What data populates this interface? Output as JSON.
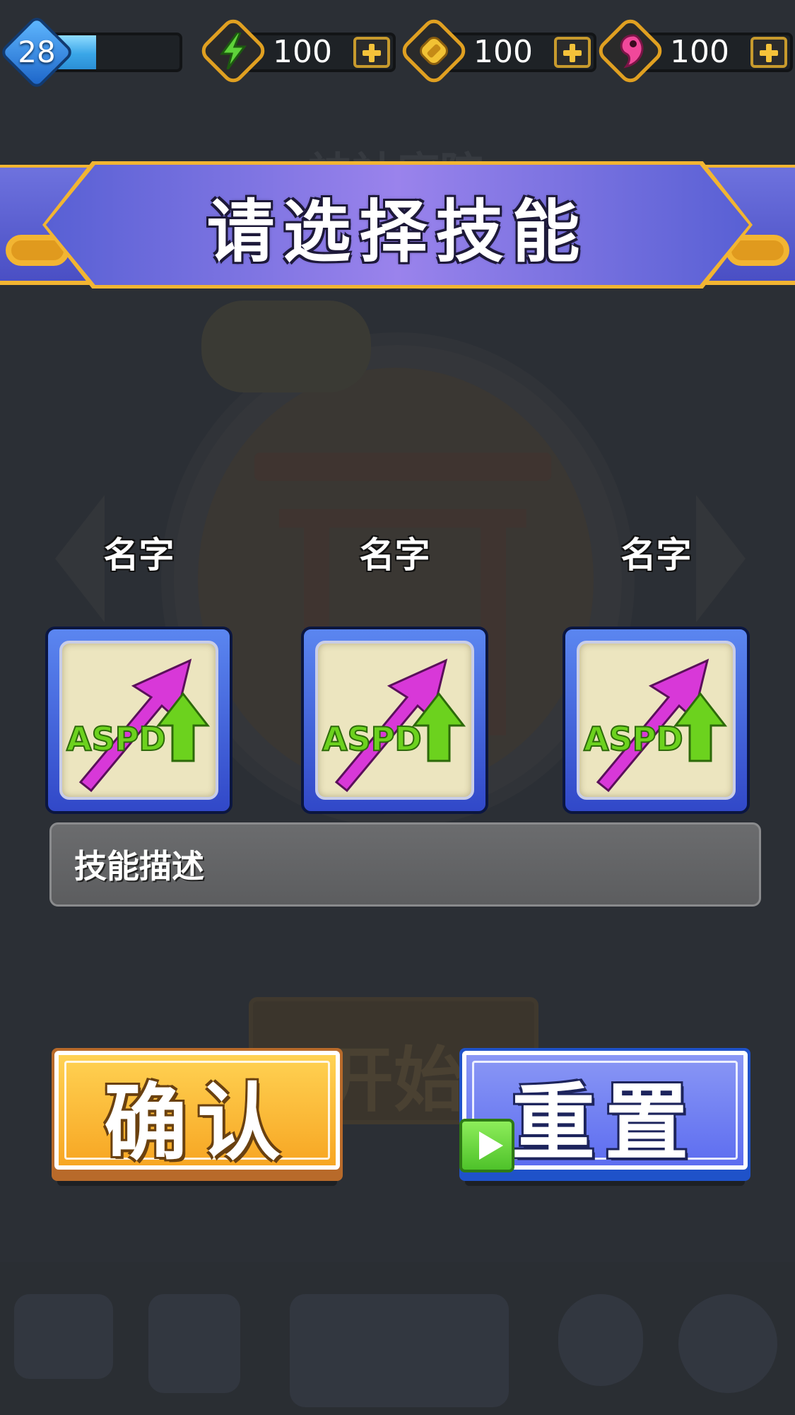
{
  "hud": {
    "level": "28",
    "xp_progress_percent": 37,
    "resources": [
      {
        "icon": "lightning-icon",
        "value": "100",
        "color": "#5ed23a"
      },
      {
        "icon": "gold-ingot-icon",
        "value": "100",
        "color": "#f2c234"
      },
      {
        "icon": "magatama-icon",
        "value": "100",
        "color": "#f0489a"
      }
    ]
  },
  "banner": {
    "title": "请选择技能"
  },
  "skills": [
    {
      "name": "名字",
      "icon": "aspd-up-icon",
      "icon_text": "ASPD"
    },
    {
      "name": "名字",
      "icon": "aspd-up-icon",
      "icon_text": "ASPD"
    },
    {
      "name": "名字",
      "icon": "aspd-up-icon",
      "icon_text": "ASPD"
    }
  ],
  "description": {
    "text": "技能描述"
  },
  "buttons": {
    "confirm_label": "确认",
    "reset_label": "重置"
  },
  "background": {
    "start_label": "开始"
  },
  "colors": {
    "background": "#2b2f35",
    "banner_purple": "#6e72de",
    "gold_trim": "#f2b532",
    "confirm_orange": "#f7a623",
    "reset_blue": "#5d6df0",
    "card_blue": "#3148c8"
  }
}
